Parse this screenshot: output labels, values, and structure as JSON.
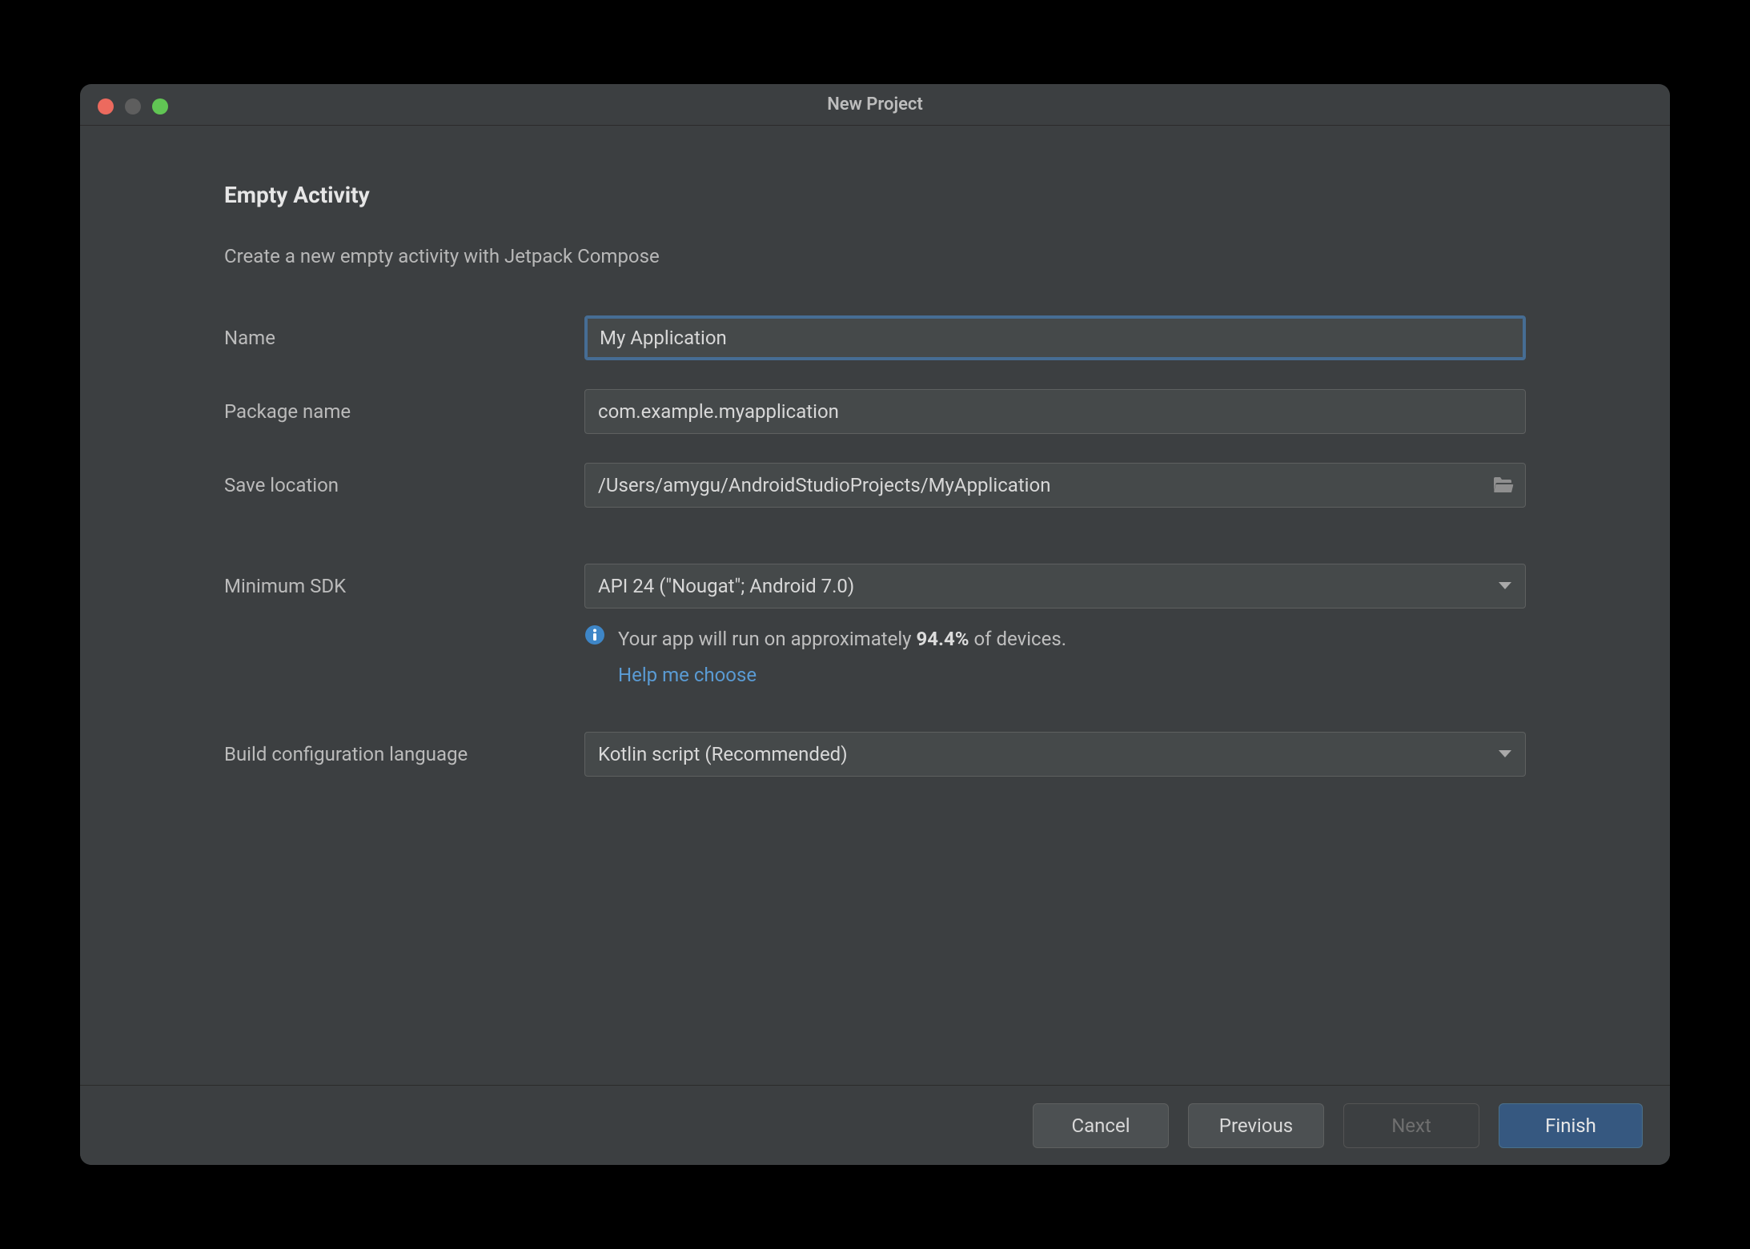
{
  "window": {
    "title": "New Project"
  },
  "page": {
    "heading": "Empty Activity",
    "subheading": "Create a new empty activity with Jetpack Compose"
  },
  "form": {
    "name_label": "Name",
    "name_value": "My Application",
    "package_label": "Package name",
    "package_value": "com.example.myapplication",
    "save_label": "Save location",
    "save_value": "/Users/amygu/AndroidStudioProjects/MyApplication",
    "sdk_label": "Minimum SDK",
    "sdk_value": "API 24 (\"Nougat\"; Android 7.0)",
    "build_label": "Build configuration language",
    "build_value": "Kotlin script (Recommended)"
  },
  "info": {
    "pre": "Your app will run on approximately ",
    "pct": "94.4%",
    "post": " of devices.",
    "help": "Help me choose"
  },
  "footer": {
    "cancel": "Cancel",
    "previous": "Previous",
    "next": "Next",
    "finish": "Finish"
  }
}
